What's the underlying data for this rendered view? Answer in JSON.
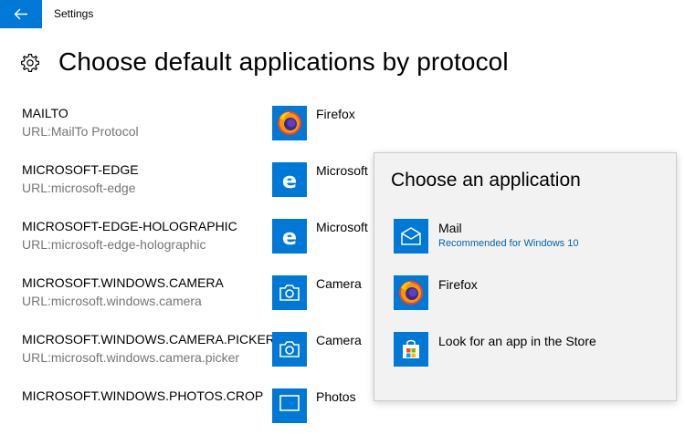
{
  "window": {
    "title": "Settings"
  },
  "page": {
    "title": "Choose default applications by protocol"
  },
  "colors": {
    "accent": "#0078d7",
    "tile": "#0078d7",
    "link": "#0063b1"
  },
  "protocols": [
    {
      "name": "MAILTO",
      "description": "URL:MailTo Protocol",
      "app": "Firefox",
      "app_icon": "firefox-icon"
    },
    {
      "name": "MICROSOFT-EDGE",
      "description": "URL:microsoft-edge",
      "app": "Microsoft",
      "app_icon": "edge-icon"
    },
    {
      "name": "MICROSOFT-EDGE-HOLOGRAPHIC",
      "description": "URL:microsoft-edge-holographic",
      "app": "Microsoft",
      "app_icon": "edge-icon"
    },
    {
      "name": "MICROSOFT.WINDOWS.CAMERA",
      "description": "URL:microsoft.windows.camera",
      "app": "Camera",
      "app_icon": "camera-icon"
    },
    {
      "name": "MICROSOFT.WINDOWS.CAMERA.PICKER",
      "description": "URL:microsoft.windows.camera.picker",
      "app": "Camera",
      "app_icon": "camera-icon"
    },
    {
      "name": "MICROSOFT.WINDOWS.PHOTOS.CROP",
      "description": "",
      "app": "Photos",
      "app_icon": "photos-icon"
    }
  ],
  "popup": {
    "title": "Choose an application",
    "items": [
      {
        "name": "Mail",
        "subtitle": "Recommended for Windows 10",
        "icon": "mail-icon"
      },
      {
        "name": "Firefox",
        "subtitle": "",
        "icon": "firefox-icon"
      },
      {
        "name": "Look for an app in the Store",
        "subtitle": "",
        "icon": "store-icon"
      }
    ]
  }
}
